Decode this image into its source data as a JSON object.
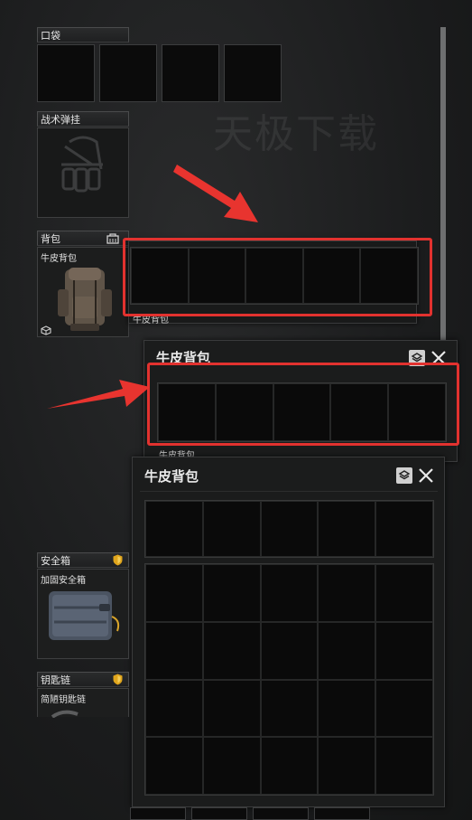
{
  "watermark": "天极下载",
  "pockets": {
    "label": "口袋",
    "slots": 4
  },
  "tactical_rig": {
    "label": "战术弹挂"
  },
  "backpack": {
    "label": "背包",
    "item_name": "牛皮背包"
  },
  "secure_container": {
    "label": "安全箱",
    "item_name": "加固安全箱"
  },
  "keychain": {
    "label": "钥匙链",
    "item_name": "简陋钥匙链"
  },
  "windows": [
    {
      "title": "牛皮背包",
      "sub_label": "牛皮背包"
    },
    {
      "title": "牛皮背包",
      "sub_label": "牛皮背包"
    },
    {
      "title": "牛皮背包"
    }
  ],
  "colors": {
    "highlight": "#e2322f",
    "arrow": "#e8342f",
    "gold_badge": "#e0a51c"
  },
  "icons": [
    "arrow-icon",
    "layers-icon",
    "close-icon",
    "shield-icon",
    "backpack-icon",
    "cube-icon"
  ]
}
